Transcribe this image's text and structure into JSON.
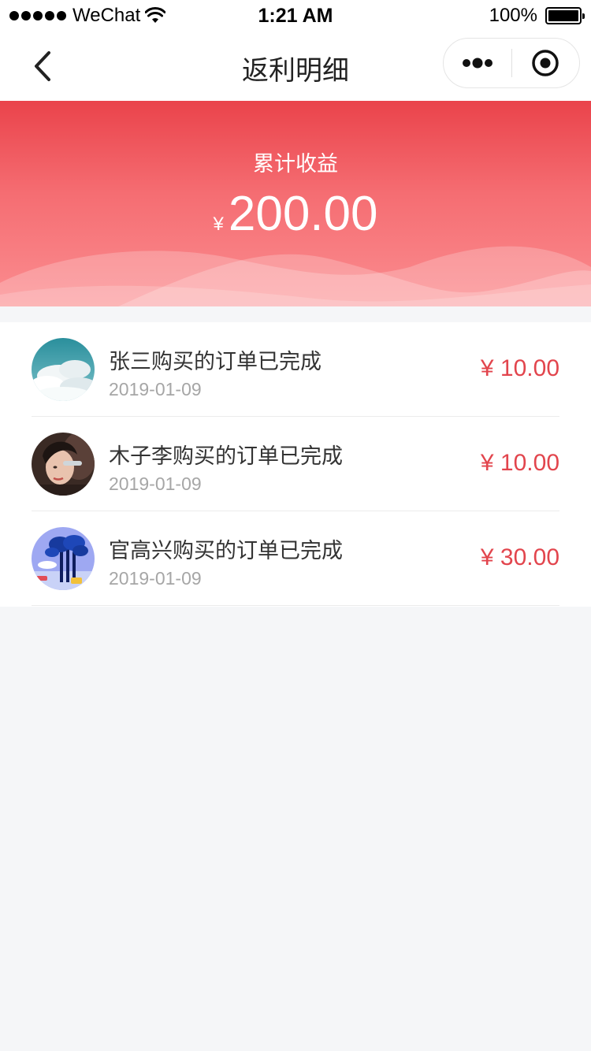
{
  "status_bar": {
    "carrier": "WeChat",
    "time": "1:21 AM",
    "battery": "100%"
  },
  "nav": {
    "title": "返利明细"
  },
  "summary": {
    "label": "累计收益",
    "currency": "¥",
    "amount": "200.00"
  },
  "records": [
    {
      "title": "张三购买的订单已完成",
      "date": "2019-01-09",
      "amount": "¥ 10.00"
    },
    {
      "title": "木子李购买的订单已完成",
      "date": "2019-01-09",
      "amount": "¥ 10.00"
    },
    {
      "title": "官高兴购买的订单已完成",
      "date": "2019-01-09",
      "amount": "¥ 30.00"
    }
  ],
  "colors": {
    "accent": "#e2454d",
    "banner_top": "#ea434b",
    "banner_bottom": "#fb8d90",
    "background": "#f5f6f8"
  }
}
